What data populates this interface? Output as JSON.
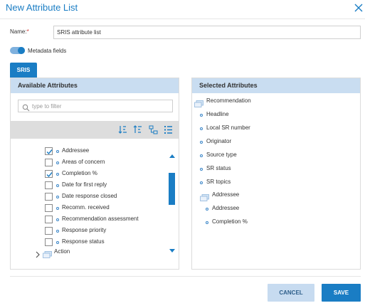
{
  "dialog": {
    "title": "New Attribute List",
    "close_icon": "close-icon"
  },
  "name_field": {
    "label": "Name:",
    "required_mark": "*",
    "value": "SRIS attribute list"
  },
  "metadata_toggle": {
    "label": "Metadata fields",
    "on": true
  },
  "tab": {
    "label": "SRIS"
  },
  "available": {
    "header": "Available Attributes",
    "filter_placeholder": "type to filter",
    "tools": [
      "sort-ascending-icon",
      "sort-descending-icon",
      "tree-view-icon",
      "list-view-icon"
    ],
    "items": [
      {
        "label": "Addressee",
        "checked": true
      },
      {
        "label": "Areas of concern",
        "checked": false
      },
      {
        "label": "Completion %",
        "checked": true
      },
      {
        "label": "Date for first reply",
        "checked": false
      },
      {
        "label": "Date response closed",
        "checked": false
      },
      {
        "label": "Recomm. received",
        "checked": false
      },
      {
        "label": "Recommendation assessment",
        "checked": false
      },
      {
        "label": "Response priority",
        "checked": false
      },
      {
        "label": "Response status",
        "checked": false
      }
    ],
    "group": {
      "label": "Action",
      "collapsed": true
    }
  },
  "selected": {
    "header": "Selected Attributes",
    "root": {
      "label": "Recommendation"
    },
    "items": [
      {
        "label": "Headline"
      },
      {
        "label": "Local SR number"
      },
      {
        "label": "Originator"
      },
      {
        "label": "Source type"
      },
      {
        "label": "SR status"
      },
      {
        "label": "SR topics"
      }
    ],
    "subgroup": {
      "label": "Addressee",
      "items": [
        {
          "label": "Addressee"
        },
        {
          "label": "Completion %"
        }
      ]
    }
  },
  "footer": {
    "cancel_label": "CANCEL",
    "save_label": "SAVE"
  },
  "colors": {
    "accent": "#1a7dc4",
    "panel_header": "#c9ddf1",
    "cancel_bg": "#c7dbf0"
  }
}
